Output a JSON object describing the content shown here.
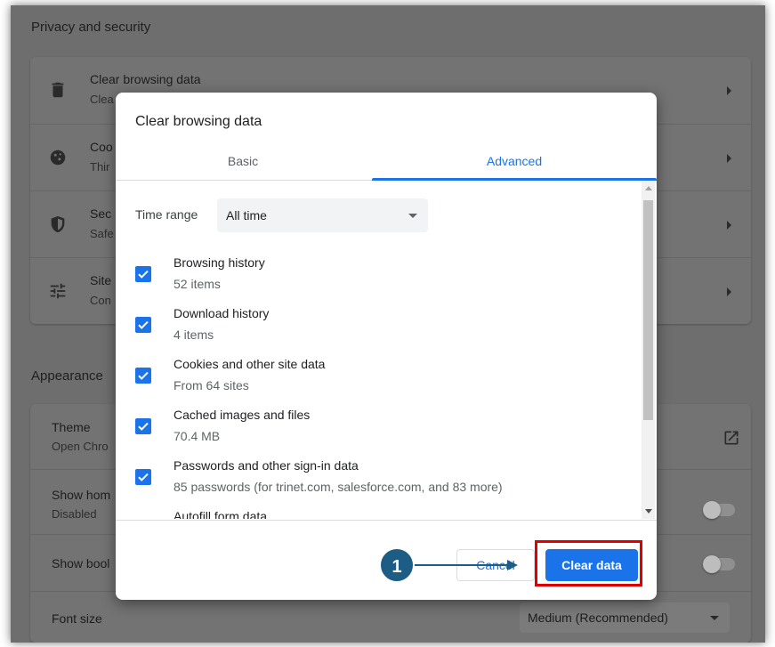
{
  "settings": {
    "privacy_title": "Privacy and security",
    "privacy_rows": [
      {
        "title": "Clear browsing data",
        "sub": "Clea",
        "icon": "trash-icon"
      },
      {
        "title": "Coo",
        "sub": "Thir",
        "icon": "cookie-icon"
      },
      {
        "title": "Sec",
        "sub": "Safe",
        "icon": "shield-icon"
      },
      {
        "title": "Site",
        "sub": "Con",
        "icon": "tune-icon"
      }
    ],
    "appearance_title": "Appearance",
    "appearance_rows": [
      {
        "title": "Theme",
        "sub": "Open Chro"
      },
      {
        "title": "Show hom",
        "sub": "Disabled"
      },
      {
        "title": "Show bool",
        "sub": ""
      },
      {
        "title": "Font size",
        "sub": "",
        "value": "Medium (Recommended)"
      }
    ]
  },
  "dialog": {
    "title": "Clear browsing data",
    "tabs": [
      "Basic",
      "Advanced"
    ],
    "active_tab": "Advanced",
    "time_range_label": "Time range",
    "time_range_value": "All time",
    "items": [
      {
        "title": "Browsing history",
        "sub": "52 items",
        "checked": true
      },
      {
        "title": "Download history",
        "sub": "4 items",
        "checked": true
      },
      {
        "title": "Cookies and other site data",
        "sub": "From 64 sites",
        "checked": true
      },
      {
        "title": "Cached images and files",
        "sub": "70.4 MB",
        "checked": true
      },
      {
        "title": "Passwords and other sign-in data",
        "sub": "85 passwords (for trinet.com, salesforce.com, and 83 more)",
        "checked": true
      },
      {
        "title": "Autofill form data",
        "sub": "",
        "checked": false
      }
    ],
    "cancel_label": "Cancel",
    "clear_label": "Clear data"
  },
  "annotation": {
    "step_number": "1",
    "highlight_color": "#e00000",
    "callout_color": "#1d5c84"
  },
  "colors": {
    "accent": "#1a73e8",
    "overlay": "#6e6e6e"
  }
}
